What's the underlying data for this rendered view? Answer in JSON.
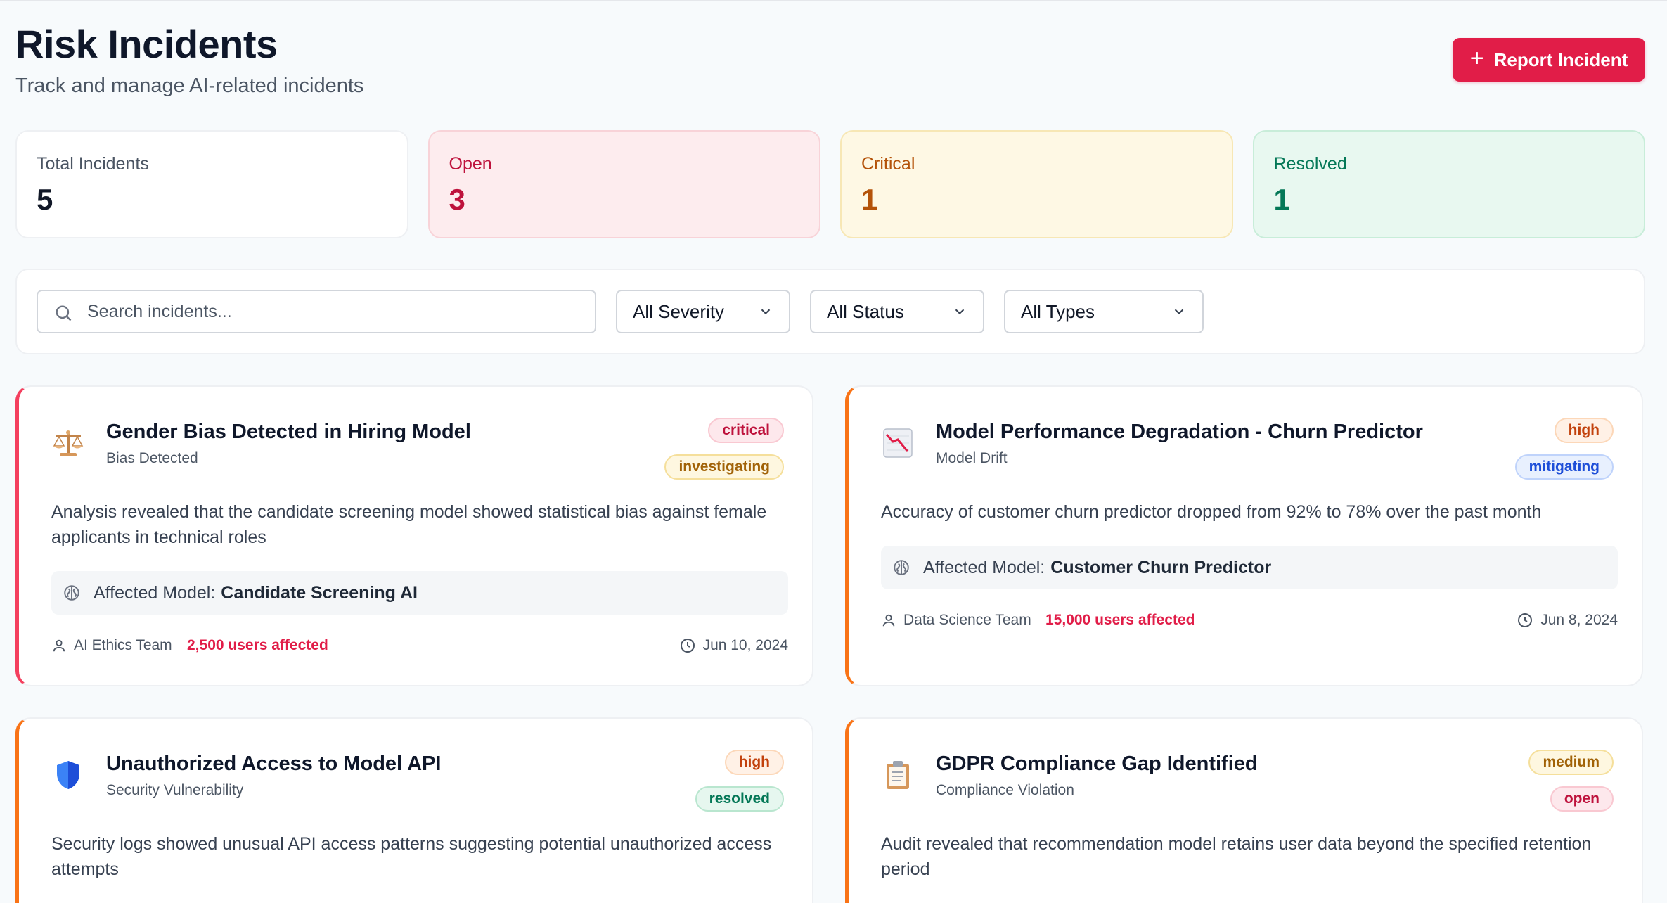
{
  "header": {
    "title": "Risk Incidents",
    "subtitle": "Track and manage AI-related incidents",
    "report_button": "Report Incident"
  },
  "stats": [
    {
      "label": "Total Incidents",
      "value": "5"
    },
    {
      "label": "Open",
      "value": "3"
    },
    {
      "label": "Critical",
      "value": "1"
    },
    {
      "label": "Resolved",
      "value": "1"
    }
  ],
  "filters": {
    "search_placeholder": "Search incidents...",
    "severity": "All Severity",
    "status": "All Status",
    "type": "All Types"
  },
  "incidents": [
    {
      "icon": "scales-icon",
      "title": "Gender Bias Detected in Hiring Model",
      "type": "Bias Detected",
      "severity": "critical",
      "status": "investigating",
      "description": "Analysis revealed that the candidate screening model showed statistical bias against female applicants in technical roles",
      "affected_label": "Affected Model:",
      "affected_model": "Candidate Screening AI",
      "team": "AI Ethics Team",
      "users": "2,500 users affected",
      "date": "Jun 10, 2024",
      "colors": {
        "accent": "#f43f5e"
      }
    },
    {
      "icon": "chart-down-icon",
      "title": "Model Performance Degradation - Churn Predictor",
      "type": "Model Drift",
      "severity": "high",
      "status": "mitigating",
      "description": "Accuracy of customer churn predictor dropped from 92% to 78% over the past month",
      "affected_label": "Affected Model:",
      "affected_model": "Customer Churn Predictor",
      "team": "Data Science Team",
      "users": "15,000 users affected",
      "date": "Jun 8, 2024",
      "colors": {
        "accent": "#f97316"
      }
    },
    {
      "icon": "shield-icon",
      "title": "Unauthorized Access to Model API",
      "type": "Security Vulnerability",
      "severity": "high",
      "status": "resolved",
      "description": "Security logs showed unusual API access patterns suggesting potential unauthorized access attempts",
      "colors": {
        "accent": "#f97316"
      }
    },
    {
      "icon": "clipboard-icon",
      "title": "GDPR Compliance Gap Identified",
      "type": "Compliance Violation",
      "severity": "medium",
      "status": "open",
      "description": "Audit revealed that recommendation model retains user data beyond the specified retention period",
      "colors": {
        "accent": "#f97316"
      }
    }
  ],
  "colors": {
    "primary": "#e11d48",
    "background": "#f7fafc"
  }
}
